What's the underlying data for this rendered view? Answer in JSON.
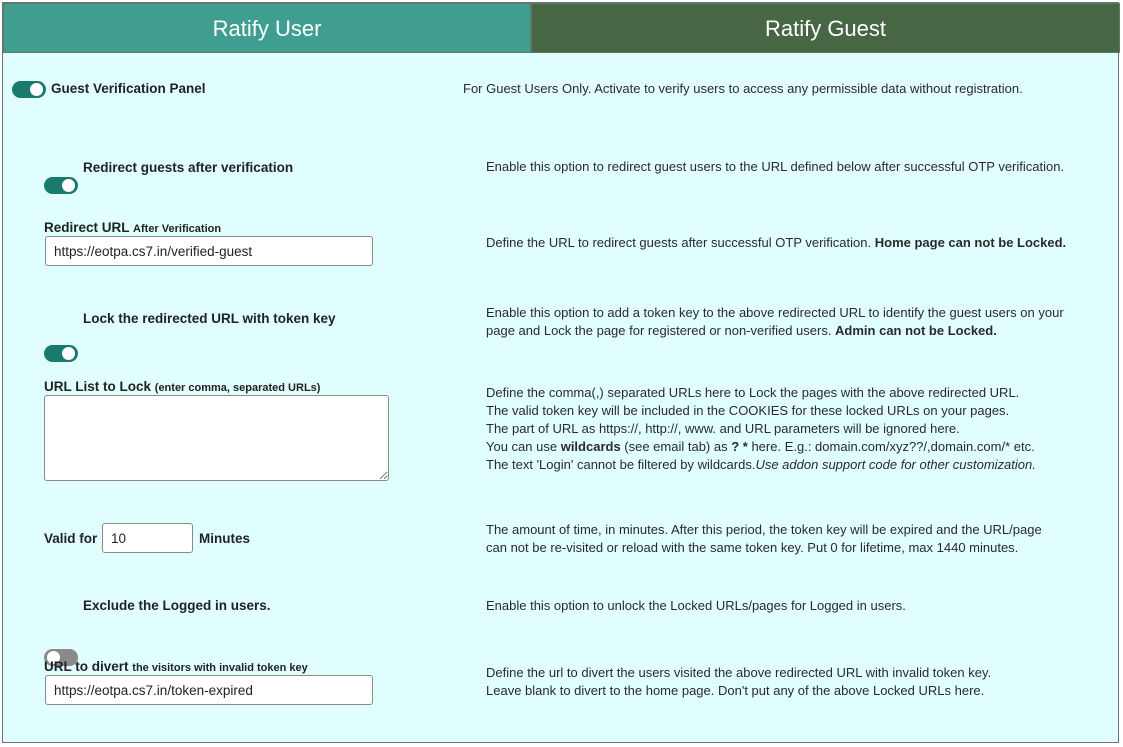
{
  "tabs": {
    "user": "Ratify User",
    "guest": "Ratify Guest"
  },
  "panel": {
    "label": "Guest Verification Panel",
    "desc": "For Guest Users Only. Activate to verify users to access any permissible data without registration.",
    "enabled": true
  },
  "redirect": {
    "label": "Redirect guests after verification",
    "desc": "Enable this option to redirect guest users to the URL defined below after successful OTP verification.",
    "enabled": true
  },
  "redirect_url": {
    "label": "Redirect URL",
    "label_small": "After Verification",
    "value": "https://eotpa.cs7.in/verified-guest",
    "desc": "Define the URL to redirect guests after successful OTP verification. ",
    "desc_bold": "Home page can not be Locked."
  },
  "lock": {
    "label": "Lock the redirected URL with token key",
    "desc_line1": "Enable this option to add a token key to the above redirected URL to identify the guest users on your",
    "desc_line2": "page and Lock the page for registered or non-verified users. ",
    "desc_bold": "Admin can not be Locked.",
    "enabled": true
  },
  "url_list": {
    "label": "URL List to Lock",
    "label_small": "(enter comma, separated URLs)",
    "value": "",
    "desc_line1": "Define the comma(,) separated URLs here to Lock the pages with the above redirected URL.",
    "desc_line2": "The valid token key will be included in the COOKIES for these locked URLs on your pages.",
    "desc_line3": "The part of URL as https://, http://, www. and URL parameters will be ignored here.",
    "desc_line4_a": "You can use ",
    "desc_line4_bold1": "wildcards",
    "desc_line4_b": " (see email tab) as ",
    "desc_line4_bold2": "? *",
    "desc_line4_c": " here. E.g.: domain.com/xyz??/,domain.com/* etc.",
    "desc_line5_a": "The text 'Login' cannot be filtered by wildcards.",
    "desc_line5_italic": "Use addon support code for other customization."
  },
  "valid_for": {
    "label": "Valid for",
    "value": "10",
    "unit": "Minutes",
    "desc_line1": "The amount of time, in minutes. After this period, the token key will be expired and the URL/page",
    "desc_line2": "can not be re-visited or reload with the same token key. Put 0 for lifetime, max 1440 minutes."
  },
  "exclude": {
    "label": "Exclude the Logged in users.",
    "desc": "Enable this option to unlock the Locked URLs/pages for Logged in users.",
    "enabled": false
  },
  "divert": {
    "label": "URL to divert",
    "label_small": "the visitors with invalid token key",
    "value": "https://eotpa.cs7.in/token-expired",
    "desc_line1": "Define the url to divert the users visited the above redirected URL with invalid token key.",
    "desc_line2": "Leave blank to divert to the home page. Don't put any of the above Locked URLs here."
  },
  "colors": {
    "tab_user": "#3f9e8f",
    "tab_guest": "#466644",
    "panel_bg": "#e0fefe",
    "toggle_on": "#1a7a6e",
    "toggle_off": "#8a8a8a"
  }
}
